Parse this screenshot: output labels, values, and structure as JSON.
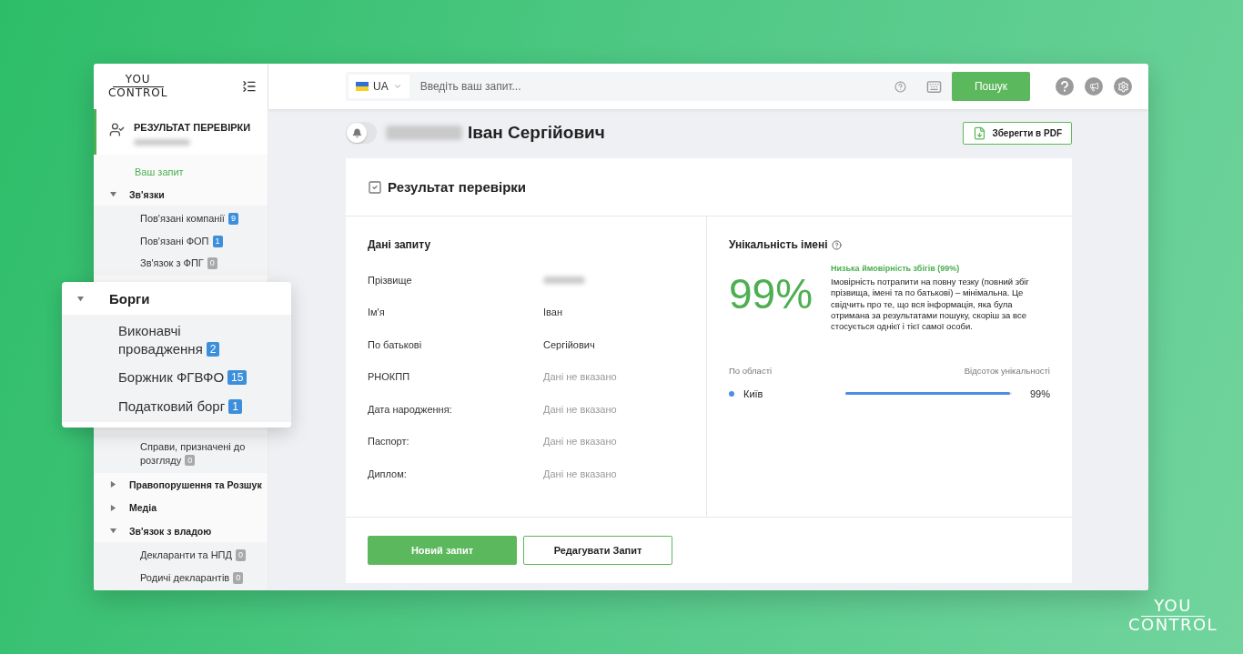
{
  "logo": {
    "top": "YOU",
    "bottom": "CONTROL"
  },
  "sidebar": {
    "header": {
      "title": "РЕЗУЛЬТАТ ПЕРЕВІРКИ",
      "subtitle_redacted": true
    },
    "link": {
      "label": "Ваш запит",
      "selected": true
    },
    "groups": [
      {
        "label": "Зв'язки",
        "expanded": true,
        "children": [
          {
            "label": "Пов'язані компанії",
            "count": "9",
            "color": "#3d8fdb"
          },
          {
            "label": "Пов'язані ФОП",
            "count": "1",
            "color": "#3d8fdb"
          },
          {
            "label": "Зв'язок з ФПГ",
            "count": "0",
            "color": "#a9a9a9"
          }
        ]
      },
      {
        "children": [
          {
            "label": "Справи, призначені до розгляду",
            "count": "0",
            "color": "#a9a9a9"
          }
        ]
      },
      {
        "label": "Правопорушення та Розшук",
        "expanded": false
      },
      {
        "label": "Медіа",
        "expanded": false
      },
      {
        "label": "Зв'язок з владою",
        "expanded": true,
        "children": [
          {
            "label": "Декларанти та НПД",
            "count": "0",
            "color": "#a9a9a9"
          },
          {
            "label": "Родичі декларантів",
            "count": "0",
            "color": "#a9a9a9"
          }
        ]
      }
    ]
  },
  "callout": {
    "label": "Борги",
    "expanded": true,
    "children": [
      {
        "label": "Виконавчі провадження",
        "count": "2",
        "color": "#3d8fdb"
      },
      {
        "label": "Боржник ФГВФО",
        "count": "15",
        "color": "#3d8fdb"
      },
      {
        "label": "Податковий борг",
        "count": "1",
        "color": "#3d8fdb"
      }
    ]
  },
  "search": {
    "language": "UA",
    "placeholder": "Введіть ваш запит...",
    "button": "Пошук"
  },
  "person": {
    "surname_redacted": true,
    "name": "Іван Сергійович",
    "alerts_on": false
  },
  "pdf_button": "Зберегти в PDF",
  "card": {
    "title": "Результат перевірки",
    "query": {
      "title": "Дані запиту",
      "rows": [
        {
          "label": "Прізвище",
          "kind": "redacted"
        },
        {
          "label": "Ім'я",
          "kind": "text",
          "value": "Іван"
        },
        {
          "label": "По батькові",
          "kind": "text",
          "value": "Сергійович"
        },
        {
          "label": "РНОКПП",
          "kind": "missing",
          "value": "Дані не вказано"
        },
        {
          "label": "Дата народження:",
          "kind": "missing",
          "value": "Дані не вказано"
        },
        {
          "label": "Паспорт:",
          "kind": "missing",
          "value": "Дані не вказано"
        },
        {
          "label": "Диплом:",
          "kind": "missing",
          "value": "Дані не вказано"
        }
      ]
    },
    "uniqueness": {
      "title": "Унікальність імені",
      "percent": "99%",
      "verdict": "Низька ймовірність збігів (99%)",
      "description": "Імовірність потрапити на повну тезку (повний збіг прізвища, імені та по батькові) – мінімальна. Це свідчить про те, що вся інформація, яка була отримана за результатами пошуку, скоріш за все стосується однієї і тієї самої особи.",
      "columns": [
        "По області",
        "Відсоток унікальності"
      ],
      "regions": [
        {
          "name": "Київ",
          "color": "#4a90e2",
          "level": 0.99,
          "reading": "99%"
        }
      ]
    },
    "buttons": [
      {
        "label": "Новий запит",
        "kind": "primary"
      },
      {
        "label": "Редагувати Запит",
        "kind": "secondary"
      }
    ]
  },
  "brand_logo": {
    "top": "YOU",
    "bottom": "CONTROL"
  }
}
